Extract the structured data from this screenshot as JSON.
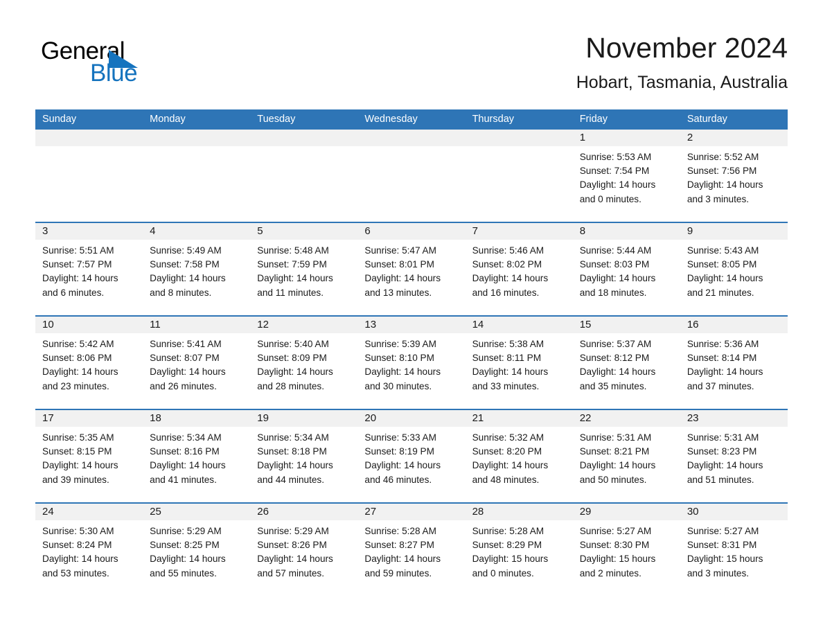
{
  "logo": {
    "word_one": "General",
    "word_two": "Blue",
    "accent_color": "#1573be"
  },
  "header": {
    "month_title": "November 2024",
    "location": "Hobart, Tasmania, Australia",
    "header_bg_color": "#2e75b6",
    "day_band_color": "#f1f1f1"
  },
  "weekdays": [
    "Sunday",
    "Monday",
    "Tuesday",
    "Wednesday",
    "Thursday",
    "Friday",
    "Saturday"
  ],
  "weeks": [
    [
      {
        "day": "",
        "lines": []
      },
      {
        "day": "",
        "lines": []
      },
      {
        "day": "",
        "lines": []
      },
      {
        "day": "",
        "lines": []
      },
      {
        "day": "",
        "lines": []
      },
      {
        "day": "1",
        "lines": [
          "Sunrise: 5:53 AM",
          "Sunset: 7:54 PM",
          "Daylight: 14 hours",
          "and 0 minutes."
        ]
      },
      {
        "day": "2",
        "lines": [
          "Sunrise: 5:52 AM",
          "Sunset: 7:56 PM",
          "Daylight: 14 hours",
          "and 3 minutes."
        ]
      }
    ],
    [
      {
        "day": "3",
        "lines": [
          "Sunrise: 5:51 AM",
          "Sunset: 7:57 PM",
          "Daylight: 14 hours",
          "and 6 minutes."
        ]
      },
      {
        "day": "4",
        "lines": [
          "Sunrise: 5:49 AM",
          "Sunset: 7:58 PM",
          "Daylight: 14 hours",
          "and 8 minutes."
        ]
      },
      {
        "day": "5",
        "lines": [
          "Sunrise: 5:48 AM",
          "Sunset: 7:59 PM",
          "Daylight: 14 hours",
          "and 11 minutes."
        ]
      },
      {
        "day": "6",
        "lines": [
          "Sunrise: 5:47 AM",
          "Sunset: 8:01 PM",
          "Daylight: 14 hours",
          "and 13 minutes."
        ]
      },
      {
        "day": "7",
        "lines": [
          "Sunrise: 5:46 AM",
          "Sunset: 8:02 PM",
          "Daylight: 14 hours",
          "and 16 minutes."
        ]
      },
      {
        "day": "8",
        "lines": [
          "Sunrise: 5:44 AM",
          "Sunset: 8:03 PM",
          "Daylight: 14 hours",
          "and 18 minutes."
        ]
      },
      {
        "day": "9",
        "lines": [
          "Sunrise: 5:43 AM",
          "Sunset: 8:05 PM",
          "Daylight: 14 hours",
          "and 21 minutes."
        ]
      }
    ],
    [
      {
        "day": "10",
        "lines": [
          "Sunrise: 5:42 AM",
          "Sunset: 8:06 PM",
          "Daylight: 14 hours",
          "and 23 minutes."
        ]
      },
      {
        "day": "11",
        "lines": [
          "Sunrise: 5:41 AM",
          "Sunset: 8:07 PM",
          "Daylight: 14 hours",
          "and 26 minutes."
        ]
      },
      {
        "day": "12",
        "lines": [
          "Sunrise: 5:40 AM",
          "Sunset: 8:09 PM",
          "Daylight: 14 hours",
          "and 28 minutes."
        ]
      },
      {
        "day": "13",
        "lines": [
          "Sunrise: 5:39 AM",
          "Sunset: 8:10 PM",
          "Daylight: 14 hours",
          "and 30 minutes."
        ]
      },
      {
        "day": "14",
        "lines": [
          "Sunrise: 5:38 AM",
          "Sunset: 8:11 PM",
          "Daylight: 14 hours",
          "and 33 minutes."
        ]
      },
      {
        "day": "15",
        "lines": [
          "Sunrise: 5:37 AM",
          "Sunset: 8:12 PM",
          "Daylight: 14 hours",
          "and 35 minutes."
        ]
      },
      {
        "day": "16",
        "lines": [
          "Sunrise: 5:36 AM",
          "Sunset: 8:14 PM",
          "Daylight: 14 hours",
          "and 37 minutes."
        ]
      }
    ],
    [
      {
        "day": "17",
        "lines": [
          "Sunrise: 5:35 AM",
          "Sunset: 8:15 PM",
          "Daylight: 14 hours",
          "and 39 minutes."
        ]
      },
      {
        "day": "18",
        "lines": [
          "Sunrise: 5:34 AM",
          "Sunset: 8:16 PM",
          "Daylight: 14 hours",
          "and 41 minutes."
        ]
      },
      {
        "day": "19",
        "lines": [
          "Sunrise: 5:34 AM",
          "Sunset: 8:18 PM",
          "Daylight: 14 hours",
          "and 44 minutes."
        ]
      },
      {
        "day": "20",
        "lines": [
          "Sunrise: 5:33 AM",
          "Sunset: 8:19 PM",
          "Daylight: 14 hours",
          "and 46 minutes."
        ]
      },
      {
        "day": "21",
        "lines": [
          "Sunrise: 5:32 AM",
          "Sunset: 8:20 PM",
          "Daylight: 14 hours",
          "and 48 minutes."
        ]
      },
      {
        "day": "22",
        "lines": [
          "Sunrise: 5:31 AM",
          "Sunset: 8:21 PM",
          "Daylight: 14 hours",
          "and 50 minutes."
        ]
      },
      {
        "day": "23",
        "lines": [
          "Sunrise: 5:31 AM",
          "Sunset: 8:23 PM",
          "Daylight: 14 hours",
          "and 51 minutes."
        ]
      }
    ],
    [
      {
        "day": "24",
        "lines": [
          "Sunrise: 5:30 AM",
          "Sunset: 8:24 PM",
          "Daylight: 14 hours",
          "and 53 minutes."
        ]
      },
      {
        "day": "25",
        "lines": [
          "Sunrise: 5:29 AM",
          "Sunset: 8:25 PM",
          "Daylight: 14 hours",
          "and 55 minutes."
        ]
      },
      {
        "day": "26",
        "lines": [
          "Sunrise: 5:29 AM",
          "Sunset: 8:26 PM",
          "Daylight: 14 hours",
          "and 57 minutes."
        ]
      },
      {
        "day": "27",
        "lines": [
          "Sunrise: 5:28 AM",
          "Sunset: 8:27 PM",
          "Daylight: 14 hours",
          "and 59 minutes."
        ]
      },
      {
        "day": "28",
        "lines": [
          "Sunrise: 5:28 AM",
          "Sunset: 8:29 PM",
          "Daylight: 15 hours",
          "and 0 minutes."
        ]
      },
      {
        "day": "29",
        "lines": [
          "Sunrise: 5:27 AM",
          "Sunset: 8:30 PM",
          "Daylight: 15 hours",
          "and 2 minutes."
        ]
      },
      {
        "day": "30",
        "lines": [
          "Sunrise: 5:27 AM",
          "Sunset: 8:31 PM",
          "Daylight: 15 hours",
          "and 3 minutes."
        ]
      }
    ]
  ]
}
